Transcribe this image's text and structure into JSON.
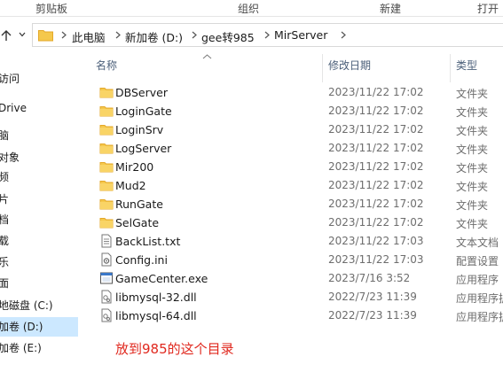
{
  "ribbon": {
    "groups": [
      "剪贴板",
      "组织",
      "新建",
      "打开"
    ]
  },
  "address": {
    "crumbs": [
      "此电脑",
      "新加卷 (D:)",
      "gee转985",
      "MirServer"
    ]
  },
  "nav_pane": {
    "items": [
      {
        "label": "访问",
        "icon": "star-icon"
      },
      {
        "label": "Drive",
        "icon": "cloud-icon"
      },
      {
        "label": "脑",
        "icon": "computer-icon"
      },
      {
        "label": "对象",
        "icon": "cube-icon"
      },
      {
        "label": "频",
        "icon": "video-icon"
      },
      {
        "label": "片",
        "icon": "picture-icon"
      },
      {
        "label": "档",
        "icon": "document-icon"
      },
      {
        "label": "载",
        "icon": "download-icon"
      },
      {
        "label": "乐",
        "icon": "music-icon"
      },
      {
        "label": "面",
        "icon": "desktop-icon"
      },
      {
        "label": "地磁盘 (C:)",
        "icon": "drive-icon"
      },
      {
        "label": "加卷 (D:)",
        "icon": "drive-icon",
        "selected": true
      },
      {
        "label": "加卷 (E:)",
        "icon": "drive-icon"
      }
    ]
  },
  "columns": {
    "name": "名称",
    "modified": "修改日期",
    "type": "类型"
  },
  "files": [
    {
      "name": "DBServer",
      "modified": "2023/11/22 17:02",
      "type": "文件夹",
      "icon": "folder-icon"
    },
    {
      "name": "LoginGate",
      "modified": "2023/11/22 17:02",
      "type": "文件夹",
      "icon": "folder-icon"
    },
    {
      "name": "LoginSrv",
      "modified": "2023/11/22 17:02",
      "type": "文件夹",
      "icon": "folder-icon"
    },
    {
      "name": "LogServer",
      "modified": "2023/11/22 17:02",
      "type": "文件夹",
      "icon": "folder-icon"
    },
    {
      "name": "Mir200",
      "modified": "2023/11/22 17:02",
      "type": "文件夹",
      "icon": "folder-icon"
    },
    {
      "name": "Mud2",
      "modified": "2023/11/22 17:02",
      "type": "文件夹",
      "icon": "folder-icon"
    },
    {
      "name": "RunGate",
      "modified": "2023/11/22 17:02",
      "type": "文件夹",
      "icon": "folder-icon"
    },
    {
      "name": "SelGate",
      "modified": "2023/11/22 17:02",
      "type": "文件夹",
      "icon": "folder-icon"
    },
    {
      "name": "BackList.txt",
      "modified": "2023/11/22 17:03",
      "type": "文本文档",
      "icon": "text-file-icon"
    },
    {
      "name": "Config.ini",
      "modified": "2023/11/22 17:03",
      "type": "配置设置",
      "icon": "config-file-icon"
    },
    {
      "name": "GameCenter.exe",
      "modified": "2023/7/16 3:52",
      "type": "应用程序",
      "icon": "exe-icon"
    },
    {
      "name": "libmysql-32.dll",
      "modified": "2022/7/23 11:39",
      "type": "应用程序扩",
      "icon": "dll-icon"
    },
    {
      "name": "libmysql-64.dll",
      "modified": "2022/7/23 11:39",
      "type": "应用程序扩",
      "icon": "dll-icon"
    }
  ],
  "annotation": "放到985的这个目录",
  "colors": {
    "folder": "#f5c84c",
    "folder_dark": "#e4a829",
    "selection": "#cce8ff",
    "annotation": "#e0281e",
    "header_text": "#4c607a"
  }
}
